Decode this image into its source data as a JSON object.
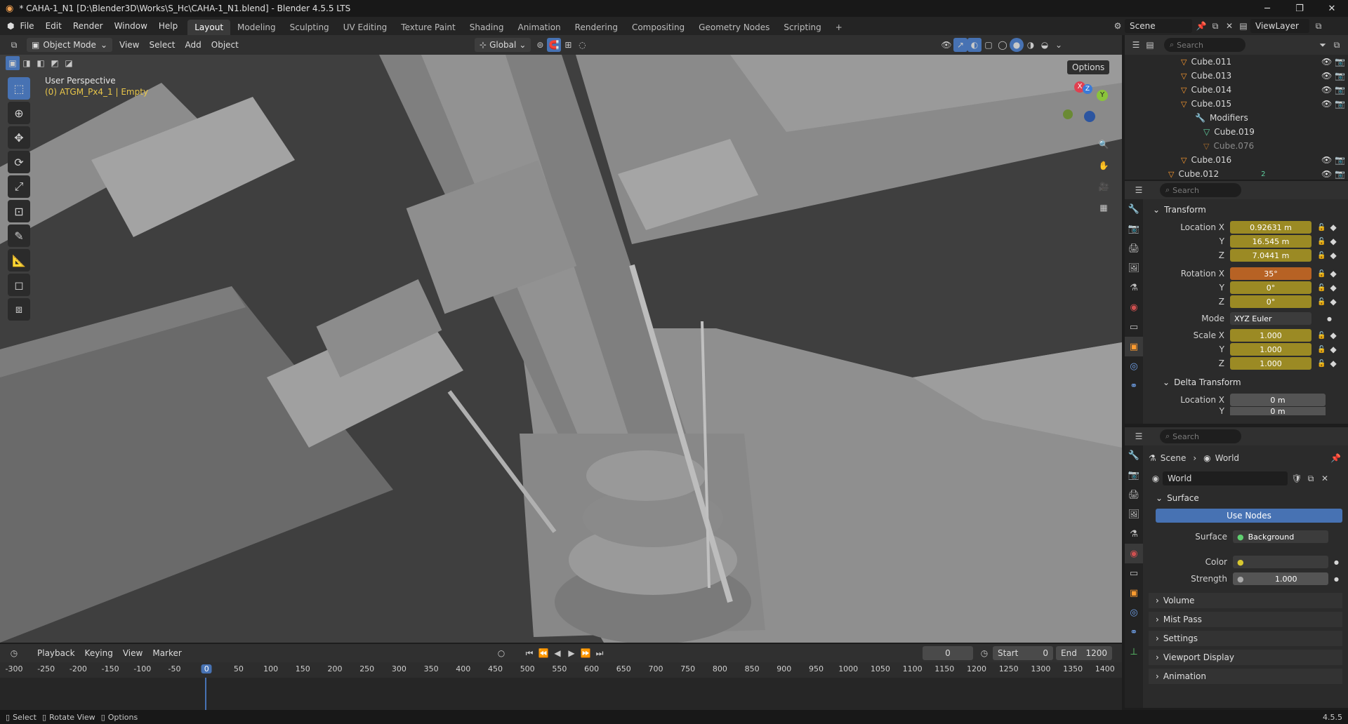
{
  "window": {
    "title": "* CAHA-1_N1 [D:\\Blender3D\\Works\\S_Hc\\CAHA-1_N1.blend] - Blender 4.5.5 LTS"
  },
  "menu": [
    "File",
    "Edit",
    "Render",
    "Window",
    "Help"
  ],
  "workspaces": [
    "Layout",
    "Modeling",
    "Sculpting",
    "UV Editing",
    "Texture Paint",
    "Shading",
    "Animation",
    "Rendering",
    "Compositing",
    "Geometry Nodes",
    "Scripting"
  ],
  "active_workspace": "Layout",
  "scene": {
    "name": "Scene",
    "view_layer": "ViewLayer"
  },
  "viewport_header": {
    "mode": "Object Mode",
    "menus": [
      "View",
      "Select",
      "Add",
      "Object"
    ],
    "transform_orientation": "Global",
    "options": "Options"
  },
  "viewport": {
    "perspective": "User Perspective",
    "active_object": "(0) ATGM_Px4_1 | Empty",
    "gizmo": {
      "x": "X",
      "y": "Y",
      "z": "Z"
    }
  },
  "outliner": {
    "search_placeholder": "Search",
    "rows": [
      {
        "name": "Cube.011"
      },
      {
        "name": "Cube.013"
      },
      {
        "name": "Cube.014"
      },
      {
        "name": "Cube.015"
      },
      {
        "name": "Modifiers"
      },
      {
        "name": "Cube.019"
      },
      {
        "name": "Cube.076"
      },
      {
        "name": "Cube.016"
      },
      {
        "name": "Cube.012"
      }
    ],
    "badge": "2"
  },
  "properties_object": {
    "search_placeholder": "Search",
    "transform_title": "Transform",
    "location_label": "Location X",
    "location": {
      "x": "0.92631 m",
      "y": "16.545 m",
      "z": "7.0441 m"
    },
    "rotation_label": "Rotation X",
    "rotation": {
      "x": "35°",
      "y": "0°",
      "z": "0°"
    },
    "mode_label": "Mode",
    "mode": "XYZ Euler",
    "scale_label": "Scale X",
    "scale": {
      "x": "1.000",
      "y": "1.000",
      "z": "1.000"
    },
    "axis_y": "Y",
    "axis_z": "Z",
    "delta_title": "Delta Transform",
    "delta_location_label": "Location X",
    "delta_location_x": "0 m",
    "delta_location_y": "0 m"
  },
  "properties_world": {
    "search_placeholder": "Search",
    "breadcrumb_scene": "Scene",
    "breadcrumb_world": "World",
    "world_name": "World",
    "surface_title": "Surface",
    "use_nodes": "Use Nodes",
    "surface_label": "Surface",
    "surface_value": "Background",
    "color_label": "Color",
    "strength_label": "Strength",
    "strength": "1.000",
    "sections": [
      "Volume",
      "Mist Pass",
      "Settings",
      "Viewport Display",
      "Animation"
    ]
  },
  "timeline": {
    "menus": [
      "Playback",
      "Keying",
      "View",
      "Marker"
    ],
    "current_frame": "0",
    "start_label": "Start",
    "start": "0",
    "end_label": "End",
    "end": "1200",
    "ticks": [
      "-300",
      "-250",
      "-200",
      "-150",
      "-100",
      "-50",
      "0",
      "50",
      "100",
      "150",
      "200",
      "250",
      "300",
      "350",
      "400",
      "450",
      "500",
      "550",
      "600",
      "650",
      "700",
      "750",
      "800",
      "850",
      "900",
      "950",
      "1000",
      "1050",
      "1100",
      "1150",
      "1200",
      "1250",
      "1300",
      "1350",
      "1400"
    ]
  },
  "status_bar": {
    "select": "Select",
    "rotate": "Rotate View",
    "options": "Options",
    "version": "4.5.5"
  },
  "colors": {
    "accent": "#4772b3",
    "keyframe_field": "#9b8a24",
    "rotation_field": "#b76224"
  }
}
